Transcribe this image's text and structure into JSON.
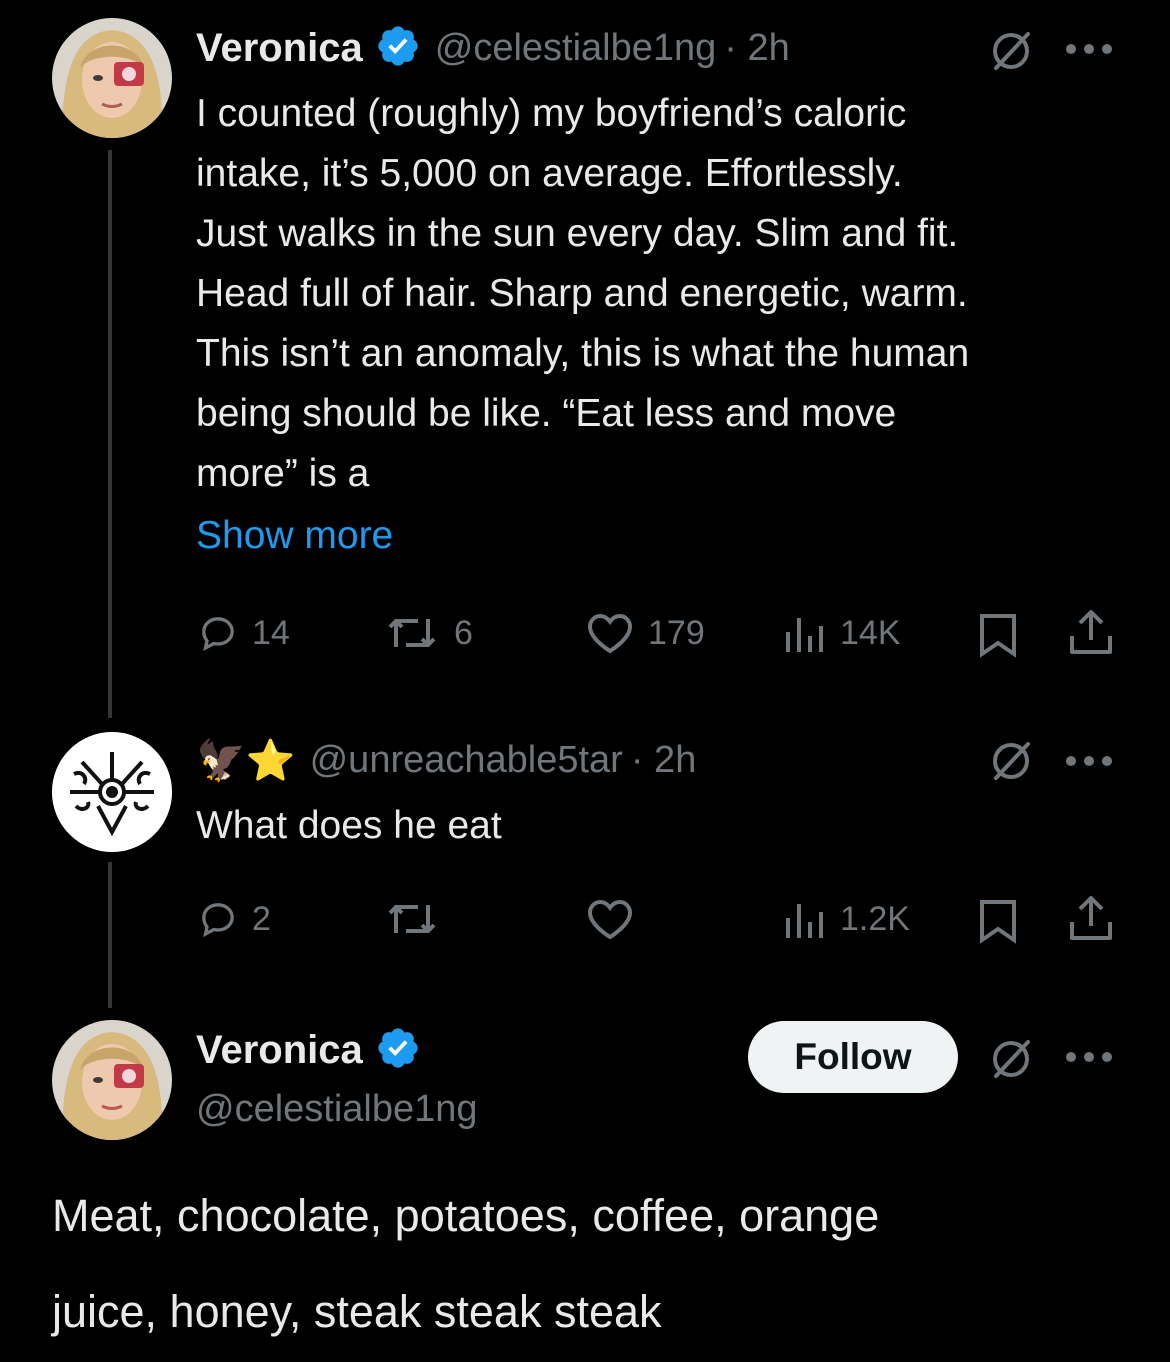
{
  "tweet1": {
    "name": "Veronica",
    "handle": "@celestialbe1ng",
    "time": "· 2h",
    "lines": [
      "I counted (roughly) my boyfriend’s caloric",
      "intake, it’s 5,000 on average. Effortlessly.",
      "Just walks in the sun every day. Slim and fit.",
      "Head full of hair. Sharp and energetic, warm.",
      "This isn’t an anomaly, this is what the human",
      "being should be like. “Eat less and move",
      "more” is a"
    ],
    "show_more": "Show more",
    "replies": "14",
    "reposts": "6",
    "likes": "179",
    "views": "14K"
  },
  "tweet2": {
    "emoji": "🦅⭐",
    "handle": "@unreachable5tar",
    "time": "· 2h",
    "text": "What does he eat",
    "replies": "2",
    "views": "1.2K"
  },
  "tweet3": {
    "name": "Veronica",
    "handle": "@celestialbe1ng",
    "follow_label": "Follow",
    "lines": [
      "Meat, chocolate, potatoes, coffee, orange",
      "juice, honey, steak steak steak"
    ]
  },
  "colors": {
    "background": "#000000",
    "text": "#e7e9ea",
    "muted": "#71767b",
    "link": "#1d9bf0",
    "verified": "#1d9bf0"
  }
}
